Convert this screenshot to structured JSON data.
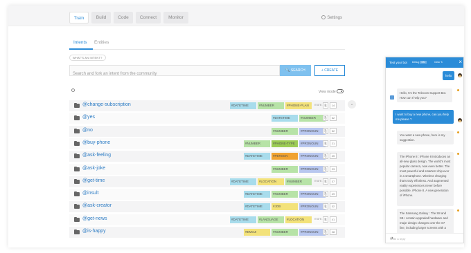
{
  "nav": {
    "tabs": [
      "Train",
      "Build",
      "Code",
      "Connect",
      "Monitor"
    ],
    "active": "Train",
    "settings_label": "Settings"
  },
  "subtabs": [
    "Intents",
    "Entities"
  ],
  "what_is_intent": "WHAT'S AN INTENT?",
  "search": {
    "placeholder": "Search and fork an intent from the community",
    "search_button": "SEARCH",
    "create_button": "CREATE"
  },
  "view_mode_label": "View mode",
  "intents": [
    {
      "name": "@change-subscription",
      "tags": [
        {
          "label": "#DATETIME",
          "color": "#a8dcec"
        },
        {
          "label": "#NUMBER",
          "color": "#b7e3a7"
        },
        {
          "label": "#PHONE-PLAN",
          "color": "#f3e27a"
        }
      ],
      "more": "more...",
      "count": "14"
    },
    {
      "name": "@yes",
      "tags": [
        {
          "label": "#DATETIME",
          "color": "#a8dcec"
        },
        {
          "label": "#NUMBER",
          "color": "#b7e3a7"
        }
      ],
      "more": "",
      "count": "62"
    },
    {
      "name": "@no",
      "tags": [
        {
          "label": "#NUMBER",
          "color": "#b7e3a7"
        },
        {
          "label": "#PRONOUN",
          "color": "#b8c7ef"
        }
      ],
      "more": "",
      "count": "52"
    },
    {
      "name": "@buy-phone",
      "tags": [
        {
          "label": "#NUMBER",
          "color": "#b7e3a7"
        },
        {
          "label": "#PHONE-TYPE",
          "color": "#9ccc55"
        },
        {
          "label": "#PRONOUN",
          "color": "#b8c7ef"
        }
      ],
      "more": "",
      "count": "21"
    },
    {
      "name": "@ask-feeling",
      "tags": [
        {
          "label": "#DATETIME",
          "color": "#a8dcec"
        },
        {
          "label": "#PERSON",
          "color": "#f0a230"
        },
        {
          "label": "#PRONOUN",
          "color": "#b8c7ef"
        }
      ],
      "more": "",
      "count": "45"
    },
    {
      "name": "@ask-joke",
      "tags": [
        {
          "label": "#NUMBER",
          "color": "#b7e3a7"
        },
        {
          "label": "#PRONOUN",
          "color": "#b8c7ef"
        }
      ],
      "more": "",
      "count": "23"
    },
    {
      "name": "@get-time",
      "tags": [
        {
          "label": "#DATETIME",
          "color": "#a8dcec"
        },
        {
          "label": "#LOCATION",
          "color": "#f3e27a"
        },
        {
          "label": "#NUMBER",
          "color": "#b7e3a7"
        }
      ],
      "more": "more...",
      "count": "37"
    },
    {
      "name": "@insult",
      "tags": [
        {
          "label": "#DATETIME",
          "color": "#a8dcec"
        },
        {
          "label": "#NUMBER",
          "color": "#b7e3a7"
        },
        {
          "label": "#PRONOUN",
          "color": "#b8c7ef"
        }
      ],
      "more": "",
      "count": "49"
    },
    {
      "name": "@ask-creator",
      "tags": [
        {
          "label": "#DATETIME",
          "color": "#a8dcec"
        },
        {
          "label": "#JOB",
          "color": "#f3e27a"
        },
        {
          "label": "#PRONOUN",
          "color": "#b8c7ef"
        }
      ],
      "more": "",
      "count": "32"
    },
    {
      "name": "@get-news",
      "tags": [
        {
          "label": "#DATETIME",
          "color": "#a8dcec"
        },
        {
          "label": "#LANGUAGE",
          "color": "#b7e3a7"
        },
        {
          "label": "#LOCATION",
          "color": "#f3e27a"
        }
      ],
      "more": "more...",
      "count": "41"
    },
    {
      "name": "@is-happy",
      "tags": [
        {
          "label": "#EMOJI",
          "color": "#f3e27a"
        },
        {
          "label": "#NUMBER",
          "color": "#b7e3a7"
        },
        {
          "label": "#PRONOUN",
          "color": "#b8c7ef"
        }
      ],
      "more": "",
      "count": "28"
    }
  ],
  "chat": {
    "title": "Test your bot",
    "debug_label": "Debug",
    "debug_state": "ON",
    "clear_label": "Clear",
    "messages": [
      {
        "from": "user",
        "text": "hello"
      },
      {
        "from": "bot",
        "text": "Hello, I'm the Telecom Support Bot. How can I help you?"
      },
      {
        "from": "user",
        "text": "I want to buy a new phone, can you help me please ?"
      },
      {
        "from": "bot",
        "text": "You want a new phone, here is my suggestion."
      },
      {
        "from": "bot",
        "text": "The iPhone 8 : iPhone 8 introduces an all-new glass design. The world's most popular camera, now even better. The most powerful and smartest chip ever in a smartphone. Wireless charging that's truly effortless. And augmented reality experiences never before possible. iPhone 8. A new generation of iPhone."
      },
      {
        "from": "bot",
        "text": "The Samsung Galaxy : The S8 and S8+ contain upgraded hardware and major design changes over the S7 line, including larger screens with a"
      }
    ],
    "input_placeholder": "Write a reply"
  }
}
